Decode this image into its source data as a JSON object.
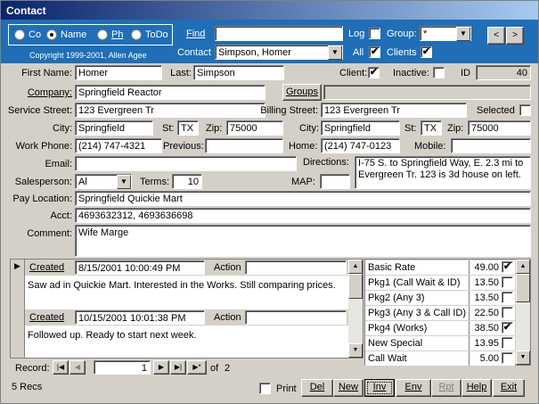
{
  "window": {
    "title": "Contact"
  },
  "header": {
    "copyright": "Copyright 1999-2001, Allen Agee",
    "sort_options": [
      {
        "label": "Co",
        "selected": false
      },
      {
        "label": "Name",
        "selected": true
      },
      {
        "label": "Ph",
        "selected": false
      },
      {
        "label": "ToDo",
        "selected": false
      }
    ],
    "find_label": "Find",
    "find_value": "",
    "contact_label": "Contact",
    "contact_value": "Simpson, Homer",
    "log_label": "Log",
    "log_checked": false,
    "all_label": "All",
    "all_checked": true,
    "group_label": "Group:",
    "group_value": "*",
    "clients_label": "Clients",
    "clients_checked": true,
    "prev_icon": "left-arrow-icon",
    "next_icon": "right-arrow-icon"
  },
  "form": {
    "first_name_label": "First Name:",
    "first_name": "Homer",
    "last_label": "Last:",
    "last_name": "Simpson",
    "client_label": "Client:",
    "client_checked": true,
    "inactive_label": "Inactive:",
    "inactive_checked": false,
    "id_label": "ID",
    "id_value": "40",
    "company_label": "Company:",
    "company": "Springfield Reactor",
    "groups_button": "Groups",
    "groups_value": "",
    "service_street_label": "Service Street:",
    "service_street": "123 Evergreen Tr",
    "billing_street_label": "Billing Street:",
    "billing_street": "123 Evergreen Tr",
    "selected_label": "Selected",
    "selected_checked": false,
    "city_label": "City:",
    "city": "Springfield",
    "st_label": "St:",
    "st": "TX",
    "zip_label": "Zip:",
    "zip": "75000",
    "billing_city_label": "City:",
    "billing_city": "Springfield",
    "billing_st_label": "St:",
    "billing_st": "TX",
    "billing_zip_label": "Zip:",
    "billing_zip": "75000",
    "work_phone_label": "Work Phone:",
    "work_phone": "(214) 747-4321",
    "previous_label": "Previous:",
    "previous": "",
    "home_label": "Home:",
    "home": "(214) 747-0123",
    "mobile_label": "Mobile:",
    "mobile": "",
    "email_label": "Email:",
    "email": "",
    "directions_label": "Directions:",
    "directions": "I-75 S. to Springfield Way, E. 2.3 mi to Evergreen Tr. 123 is 3d house on left.",
    "salesperson_label": "Salesperson:",
    "salesperson": "Al",
    "terms_label": "Terms:",
    "terms": "10",
    "map_label": "MAP:",
    "map": "",
    "pay_location_label": "Pay Location:",
    "pay_location": "Springfield Quickie Mart",
    "acct_label": "Acct:",
    "acct": "4693632312, 4693636698",
    "comment_label": "Comment:",
    "comment": "Wife Marge"
  },
  "log": {
    "created_label": "Created",
    "action_label": "Action",
    "entries": [
      {
        "created": "8/15/2001 10:00:49 PM",
        "action": "",
        "note": "Saw ad in Quickie Mart. Interested in the Works. Still comparing prices."
      },
      {
        "created": "10/15/2001 10:01:38 PM",
        "action": "",
        "note": "Followed up. Ready to start next week."
      }
    ],
    "record_label": "Record:",
    "record_value": "1",
    "record_of": "of",
    "record_total": "2"
  },
  "packages": [
    {
      "name": "Basic Rate",
      "price": "49.00",
      "checked": true
    },
    {
      "name": "Pkg1 (Call Wait & ID)",
      "price": "13.50",
      "checked": false
    },
    {
      "name": "Pkg2 (Any 3)",
      "price": "13.50",
      "checked": false
    },
    {
      "name": "Pkg3 (Any 3 & Call ID)",
      "price": "22.50",
      "checked": false
    },
    {
      "name": "Pkg4 (Works)",
      "price": "38.50",
      "checked": true
    },
    {
      "name": "New Special",
      "price": "13.95",
      "checked": false
    },
    {
      "name": "Call Wait",
      "price": "5.00",
      "checked": false
    }
  ],
  "footer": {
    "recs": "5 Recs",
    "print_label": "Print",
    "print_checked": false,
    "buttons": {
      "del": "Del",
      "new": "New",
      "inv": "Inv",
      "env": "Env",
      "rpt": "Rpt",
      "help": "Help",
      "exit": "Exit"
    }
  },
  "colors": {
    "header_bg": "#1f6eb6",
    "title_start": "#0a246a",
    "face": "#d4d0c8"
  }
}
